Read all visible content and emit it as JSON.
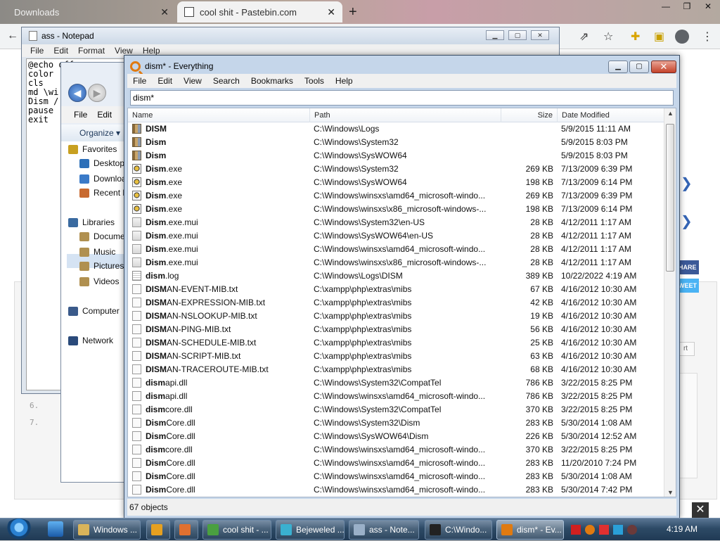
{
  "browser": {
    "tabs": [
      {
        "title": "Downloads"
      },
      {
        "title": "cool shit - Pastebin.com"
      }
    ],
    "code_line_numbers": [
      "6.",
      "7."
    ],
    "share_label": "HARE",
    "tweet_label": "WEET",
    "report_label": "rt"
  },
  "notepad": {
    "title": "ass - Notepad",
    "menu": [
      "File",
      "Edit",
      "Format",
      "View",
      "Help"
    ],
    "text": "@echo off\ncolor\ncls\nmd \\wi\nDism /\npause\nexit"
  },
  "explorer": {
    "menu": [
      "File",
      "Edit"
    ],
    "organize_label": "Organize",
    "nav_items": [
      {
        "label": "Favorites",
        "color": "#c8a020"
      },
      {
        "label": "Desktop",
        "color": "#2c6fb8"
      },
      {
        "label": "Downloads",
        "color": "#3a7ac8"
      },
      {
        "label": "Recent Places",
        "color": "#c86a30"
      },
      {
        "label": "Libraries",
        "color": "#3a6aa0"
      },
      {
        "label": "Documents",
        "color": "#b09050"
      },
      {
        "label": "Music",
        "color": "#b09050"
      },
      {
        "label": "Pictures",
        "color": "#b09050"
      },
      {
        "label": "Videos",
        "color": "#b09050"
      },
      {
        "label": "Computer",
        "color": "#3a5a8a"
      },
      {
        "label": "Network",
        "color": "#2a4a7a"
      }
    ]
  },
  "everything": {
    "title": "dism* - Everything",
    "menu": [
      "File",
      "Edit",
      "View",
      "Search",
      "Bookmarks",
      "Tools",
      "Help"
    ],
    "search_value": "dism*",
    "columns": {
      "name": "Name",
      "path": "Path",
      "size": "Size",
      "date": "Date Modified"
    },
    "rows": [
      {
        "match": "DISM",
        "rest": "",
        "icon": "folder",
        "path": "C:\\Windows\\Logs",
        "size": "",
        "date": "5/9/2015 11:11 AM"
      },
      {
        "match": "Dism",
        "rest": "",
        "icon": "folder",
        "path": "C:\\Windows\\System32",
        "size": "",
        "date": "5/9/2015 8:03 PM"
      },
      {
        "match": "Dism",
        "rest": "",
        "icon": "folder",
        "path": "C:\\Windows\\SysWOW64",
        "size": "",
        "date": "5/9/2015 8:03 PM"
      },
      {
        "match": "Dism",
        "rest": ".exe",
        "icon": "exe",
        "path": "C:\\Windows\\System32",
        "size": "269 KB",
        "date": "7/13/2009 6:39 PM"
      },
      {
        "match": "Dism",
        "rest": ".exe",
        "icon": "exe",
        "path": "C:\\Windows\\SysWOW64",
        "size": "198 KB",
        "date": "7/13/2009 6:14 PM"
      },
      {
        "match": "Dism",
        "rest": ".exe",
        "icon": "exe",
        "path": "C:\\Windows\\winsxs\\amd64_microsoft-windo...",
        "size": "269 KB",
        "date": "7/13/2009 6:39 PM"
      },
      {
        "match": "Dism",
        "rest": ".exe",
        "icon": "exe",
        "path": "C:\\Windows\\winsxs\\x86_microsoft-windows-...",
        "size": "198 KB",
        "date": "7/13/2009 6:14 PM"
      },
      {
        "match": "Dism",
        "rest": ".exe.mui",
        "icon": "mui",
        "path": "C:\\Windows\\System32\\en-US",
        "size": "28 KB",
        "date": "4/12/2011 1:17 AM"
      },
      {
        "match": "Dism",
        "rest": ".exe.mui",
        "icon": "mui",
        "path": "C:\\Windows\\SysWOW64\\en-US",
        "size": "28 KB",
        "date": "4/12/2011 1:17 AM"
      },
      {
        "match": "Dism",
        "rest": ".exe.mui",
        "icon": "mui",
        "path": "C:\\Windows\\winsxs\\amd64_microsoft-windo...",
        "size": "28 KB",
        "date": "4/12/2011 1:17 AM"
      },
      {
        "match": "Dism",
        "rest": ".exe.mui",
        "icon": "mui",
        "path": "C:\\Windows\\winsxs\\x86_microsoft-windows-...",
        "size": "28 KB",
        "date": "4/12/2011 1:17 AM"
      },
      {
        "match": "dism",
        "rest": ".log",
        "icon": "log",
        "path": "C:\\Windows\\Logs\\DISM",
        "size": "389 KB",
        "date": "10/22/2022 4:19 AM"
      },
      {
        "match": "DISM",
        "rest": "AN-EVENT-MIB.txt",
        "icon": "file",
        "path": "C:\\xampp\\php\\extras\\mibs",
        "size": "67 KB",
        "date": "4/16/2012 10:30 AM"
      },
      {
        "match": "DISM",
        "rest": "AN-EXPRESSION-MIB.txt",
        "icon": "file",
        "path": "C:\\xampp\\php\\extras\\mibs",
        "size": "42 KB",
        "date": "4/16/2012 10:30 AM"
      },
      {
        "match": "DISM",
        "rest": "AN-NSLOOKUP-MIB.txt",
        "icon": "file",
        "path": "C:\\xampp\\php\\extras\\mibs",
        "size": "19 KB",
        "date": "4/16/2012 10:30 AM"
      },
      {
        "match": "DISM",
        "rest": "AN-PING-MIB.txt",
        "icon": "file",
        "path": "C:\\xampp\\php\\extras\\mibs",
        "size": "56 KB",
        "date": "4/16/2012 10:30 AM"
      },
      {
        "match": "DISM",
        "rest": "AN-SCHEDULE-MIB.txt",
        "icon": "file",
        "path": "C:\\xampp\\php\\extras\\mibs",
        "size": "25 KB",
        "date": "4/16/2012 10:30 AM"
      },
      {
        "match": "DISM",
        "rest": "AN-SCRIPT-MIB.txt",
        "icon": "file",
        "path": "C:\\xampp\\php\\extras\\mibs",
        "size": "63 KB",
        "date": "4/16/2012 10:30 AM"
      },
      {
        "match": "DISM",
        "rest": "AN-TRACEROUTE-MIB.txt",
        "icon": "file",
        "path": "C:\\xampp\\php\\extras\\mibs",
        "size": "68 KB",
        "date": "4/16/2012 10:30 AM"
      },
      {
        "match": "dism",
        "rest": "api.dll",
        "icon": "file",
        "path": "C:\\Windows\\System32\\CompatTel",
        "size": "786 KB",
        "date": "3/22/2015 8:25 PM"
      },
      {
        "match": "dism",
        "rest": "api.dll",
        "icon": "file",
        "path": "C:\\Windows\\winsxs\\amd64_microsoft-windo...",
        "size": "786 KB",
        "date": "3/22/2015 8:25 PM"
      },
      {
        "match": "dism",
        "rest": "core.dll",
        "icon": "file",
        "path": "C:\\Windows\\System32\\CompatTel",
        "size": "370 KB",
        "date": "3/22/2015 8:25 PM"
      },
      {
        "match": "Dism",
        "rest": "Core.dll",
        "icon": "file",
        "path": "C:\\Windows\\System32\\Dism",
        "size": "283 KB",
        "date": "5/30/2014 1:08 AM"
      },
      {
        "match": "Dism",
        "rest": "Core.dll",
        "icon": "file",
        "path": "C:\\Windows\\SysWOW64\\Dism",
        "size": "226 KB",
        "date": "5/30/2014 12:52 AM"
      },
      {
        "match": "dism",
        "rest": "core.dll",
        "icon": "file",
        "path": "C:\\Windows\\winsxs\\amd64_microsoft-windo...",
        "size": "370 KB",
        "date": "3/22/2015 8:25 PM"
      },
      {
        "match": "Dism",
        "rest": "Core.dll",
        "icon": "file",
        "path": "C:\\Windows\\winsxs\\amd64_microsoft-windo...",
        "size": "283 KB",
        "date": "11/20/2010 7:24 PM"
      },
      {
        "match": "Dism",
        "rest": "Core.dll",
        "icon": "file",
        "path": "C:\\Windows\\winsxs\\amd64_microsoft-windo...",
        "size": "283 KB",
        "date": "5/30/2014 1:08 AM"
      },
      {
        "match": "Dism",
        "rest": "Core.dll",
        "icon": "file",
        "path": "C:\\Windows\\winsxs\\amd64_microsoft-windo...",
        "size": "283 KB",
        "date": "5/30/2014 7:42 PM"
      }
    ],
    "status": "67 objects"
  },
  "taskbar": {
    "tasks": [
      {
        "label": "Windows ...",
        "color": "#d9b45a"
      },
      {
        "label": "",
        "color": "#e6a020"
      },
      {
        "label": "",
        "color": "#e07030"
      },
      {
        "label": "cool shit - ...",
        "color": "#4aa040"
      },
      {
        "label": "Bejeweled ...",
        "color": "#3ab0d0"
      },
      {
        "label": "ass - Note...",
        "color": "#9ab0c8"
      },
      {
        "label": "C:\\Windo...",
        "color": "#222222"
      },
      {
        "label": "dism* - Ev...",
        "color": "#e07a10"
      }
    ],
    "clock": "4:19 AM"
  }
}
